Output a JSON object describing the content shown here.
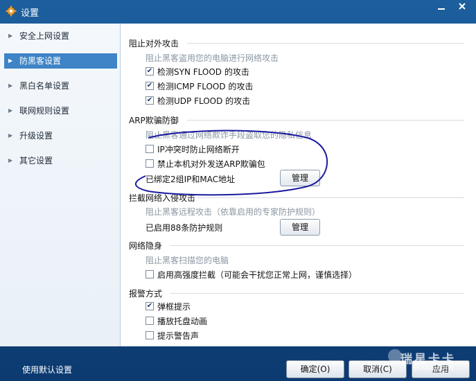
{
  "window": {
    "title": "设置",
    "icon": "gear-icon",
    "minimize_icon": "minimize-icon",
    "close_icon": "close-icon"
  },
  "sidebar": {
    "items": [
      {
        "label": "安全上网设置",
        "active": false
      },
      {
        "label": "防黑客设置",
        "active": true
      },
      {
        "label": "黑白名单设置",
        "active": false
      },
      {
        "label": "联网规则设置",
        "active": false
      },
      {
        "label": "升级设置",
        "active": false
      },
      {
        "label": "其它设置",
        "active": false
      }
    ],
    "arrow_icon": "triangle-right-icon"
  },
  "sections": {
    "block_external": {
      "title": "阻止对外攻击",
      "desc": "阻止黑客盗用您的电脑进行网络攻击",
      "items": [
        {
          "label": "检测SYN  FLOOD 的攻击",
          "checked": true
        },
        {
          "label": "检测ICMP  FLOOD 的攻击",
          "checked": true
        },
        {
          "label": "检测UDP  FLOOD 的攻击",
          "checked": true
        }
      ]
    },
    "arp": {
      "title": "ARP欺骗防御",
      "desc": "阻止黑客通过网络欺诈手段盗取您的隐私信息",
      "items": [
        {
          "label": "IP冲突时防止网络断开",
          "checked": false
        },
        {
          "label": "禁止本机对外发送ARP欺骗包",
          "checked": false
        }
      ],
      "bound_text": "已绑定2组IP和MAC地址",
      "manage_label": "管理"
    },
    "intrusion": {
      "title": "拦截网络入侵攻击",
      "desc": "阻止黑客远程攻击（依靠启用的专家防护规则）",
      "rules_text": "已启用88条防护规则",
      "manage_label": "管理"
    },
    "stealth": {
      "title": "网络隐身",
      "desc": "阻止黑客扫描您的电脑",
      "items": [
        {
          "label": "启用高强度拦截（可能会干扰您正常上网，谨慎选择）",
          "checked": false
        }
      ]
    },
    "alarm": {
      "title": "报警方式",
      "items": [
        {
          "label": "弹框提示",
          "checked": true
        },
        {
          "label": "播放托盘动画",
          "checked": false
        },
        {
          "label": "提示警告声",
          "checked": false
        }
      ]
    }
  },
  "footer": {
    "default_label": "使用默认设置",
    "ok_label": "确定(O)",
    "cancel_label": "取消(C)",
    "apply_label": "应用"
  },
  "watermark": {
    "main": "瑞星卡卡",
    "sub": "ikaka.com"
  },
  "colors": {
    "title_bar": "#1d5f9e",
    "active_nav": "#3e84c6",
    "desc_text": "#8a96a2",
    "annotation_ellipse": "#1a1aa0"
  }
}
